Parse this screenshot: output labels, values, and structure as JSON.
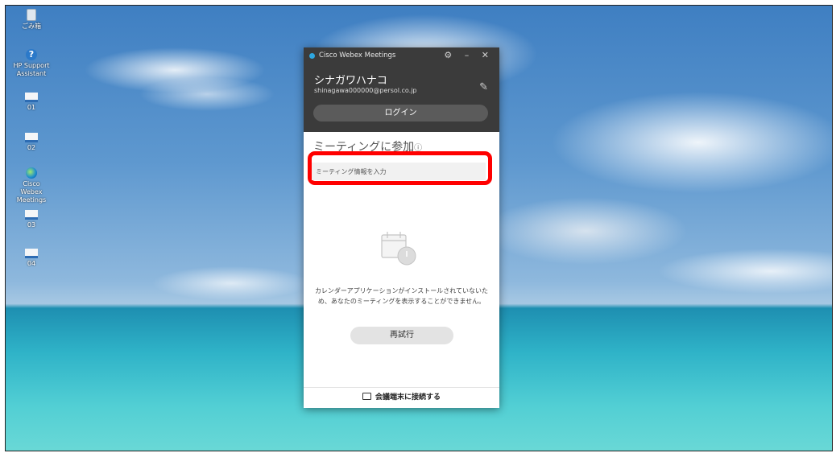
{
  "desktop": {
    "icons": [
      {
        "label": "ごみ箱",
        "icon": "recycle-bin-icon"
      },
      {
        "label": "HP Support Assistant",
        "icon": "help-icon"
      },
      {
        "label": "01",
        "icon": "document-icon"
      },
      {
        "label": "02",
        "icon": "document-icon"
      },
      {
        "label": "Cisco Webex Meetings",
        "icon": "webex-icon"
      },
      {
        "label": "03",
        "icon": "document-icon"
      },
      {
        "label": "04",
        "icon": "document-icon"
      }
    ]
  },
  "webex": {
    "title": "Cisco Webex Meetings",
    "titlebar_icons": "⚙ – ✕",
    "user_name": "シナガワハナコ",
    "user_email": "shinagawa000000@persol.co.jp",
    "login_label": "ログイン",
    "join_title": "ミーティングに参加",
    "join_info_icon": "ⓘ",
    "meeting_input_placeholder": "ミーティング情報を入力",
    "calendar_message": "カレンダーアプリケーションがインストールされていないため、あなたのミーティングを表示することができません。",
    "retry_label": "再試行",
    "footer_label": "会議端末に接続する",
    "accent_color": "#ff0000"
  }
}
